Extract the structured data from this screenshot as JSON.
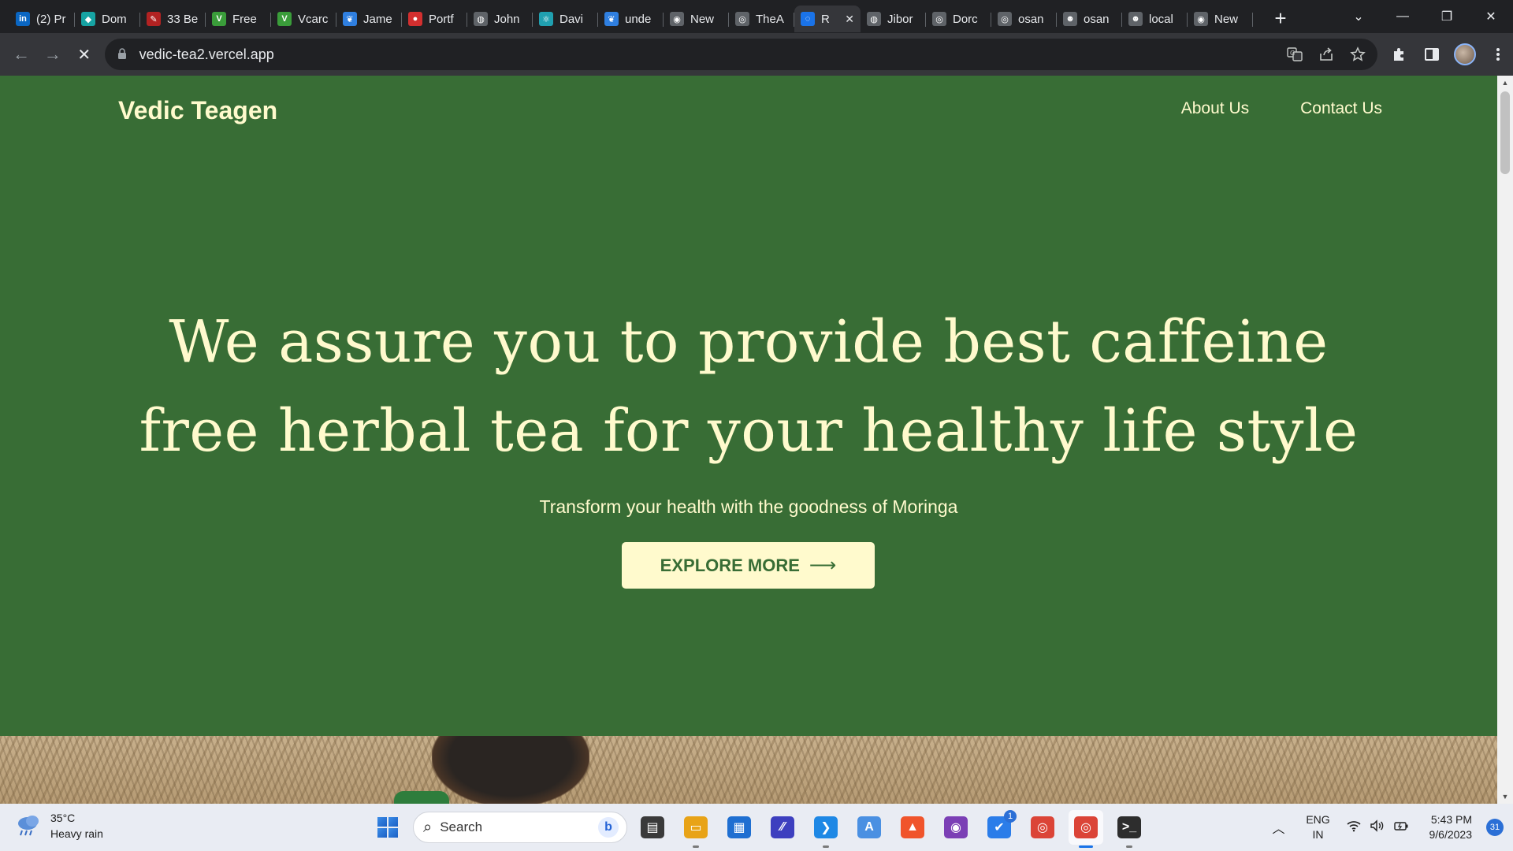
{
  "browser": {
    "tabs": [
      {
        "title": "(2) Pr",
        "fav_text": "in",
        "fav_color": "#0a66c2",
        "active": false
      },
      {
        "title": "Dom",
        "fav_text": "◆",
        "fav_color": "#16a3a3",
        "active": false
      },
      {
        "title": "33 Be",
        "fav_text": "✎",
        "fav_color": "#b22222",
        "active": false
      },
      {
        "title": "Free",
        "fav_text": "V",
        "fav_color": "#3a9d3a",
        "active": false
      },
      {
        "title": "Vcarc",
        "fav_text": "V",
        "fav_color": "#3a9d3a",
        "active": false
      },
      {
        "title": "Jame",
        "fav_text": "❦",
        "fav_color": "#2f7fe0",
        "active": false
      },
      {
        "title": "Portf",
        "fav_text": "●",
        "fav_color": "#d32f2f",
        "active": false
      },
      {
        "title": "John",
        "fav_text": "◍",
        "fav_color": "#5f6368",
        "active": false
      },
      {
        "title": "Davi",
        "fav_text": "⚛",
        "fav_color": "#20a0b0",
        "active": false
      },
      {
        "title": "unde",
        "fav_text": "❦",
        "fav_color": "#2f7fe0",
        "active": false
      },
      {
        "title": "New",
        "fav_text": "◉",
        "fav_color": "#5f6368",
        "active": false
      },
      {
        "title": "TheA",
        "fav_text": "◎",
        "fav_color": "#5f6368",
        "active": false
      },
      {
        "title": "R",
        "fav_text": "◌",
        "fav_color": "#1a73e8",
        "active": true
      },
      {
        "title": "Jibor",
        "fav_text": "◍",
        "fav_color": "#5f6368",
        "active": false
      },
      {
        "title": "Dorc",
        "fav_text": "◎",
        "fav_color": "#5f6368",
        "active": false
      },
      {
        "title": "osan",
        "fav_text": "◎",
        "fav_color": "#5f6368",
        "active": false
      },
      {
        "title": "osan",
        "fav_text": "☻",
        "fav_color": "#5f6368",
        "active": false
      },
      {
        "title": "local",
        "fav_text": "☻",
        "fav_color": "#5f6368",
        "active": false
      },
      {
        "title": "New",
        "fav_text": "◉",
        "fav_color": "#5f6368",
        "active": false
      }
    ],
    "new_tab_icon": "+",
    "close_tab_icon": "✕",
    "tab_search_icon": "⌄",
    "minimize_icon": "—",
    "restore_icon": "❐",
    "close_icon": "✕",
    "back_icon": "←",
    "forward_icon": "→",
    "stop_icon": "✕",
    "url": "vedic-tea2.vercel.app"
  },
  "site": {
    "brand": "Vedic Teagen",
    "nav": [
      "About Us",
      "Contact Us"
    ],
    "hero_title_line1": "We assure you to provide best caffeine",
    "hero_title_line2": "free herbal tea for your healthy life style",
    "hero_subtitle": "Transform your health with the goodness of Moringa",
    "cta_label": "EXPLORE MORE",
    "cta_arrow": "⟶",
    "colors": {
      "background": "#386d35",
      "text": "#fffacd"
    }
  },
  "taskbar": {
    "weather_temp": "35°C",
    "weather_desc": "Heavy rain",
    "search_placeholder": "Search",
    "apps": [
      {
        "name": "file-manager-app",
        "glyph": "▤",
        "color": "#3a3a3a",
        "running": false
      },
      {
        "name": "file-explorer-app",
        "glyph": "▭",
        "color": "#e8a317",
        "running": true
      },
      {
        "name": "microsoft-store-app",
        "glyph": "▦",
        "color": "#1f6fd1",
        "running": false
      },
      {
        "name": "visual-studio-app",
        "glyph": "⁄⁄",
        "color": "#3d3fbf",
        "running": false
      },
      {
        "name": "vscode-app",
        "glyph": "❯",
        "color": "#1e88e5",
        "running": true
      },
      {
        "name": "app-a",
        "glyph": "A",
        "color": "#4a90e2",
        "running": false
      },
      {
        "name": "brave-app",
        "glyph": "▲",
        "color": "#f0542b",
        "running": false
      },
      {
        "name": "github-desktop-app",
        "glyph": "◉",
        "color": "#7b3fb5",
        "running": false
      },
      {
        "name": "todo-app",
        "glyph": "✔",
        "color": "#2b7de9",
        "running": false,
        "badge": "1"
      },
      {
        "name": "chrome-app",
        "glyph": "◎",
        "color": "#db4437",
        "running": false
      },
      {
        "name": "chrome-profile-app",
        "glyph": "◎",
        "color": "#db4437",
        "running": true,
        "active": true
      },
      {
        "name": "terminal-app",
        "glyph": ">_",
        "color": "#2d2d2d",
        "running": true
      }
    ],
    "lang_line1": "ENG",
    "lang_line2": "IN",
    "time": "5:43 PM",
    "date": "9/6/2023",
    "notifications": "31"
  }
}
